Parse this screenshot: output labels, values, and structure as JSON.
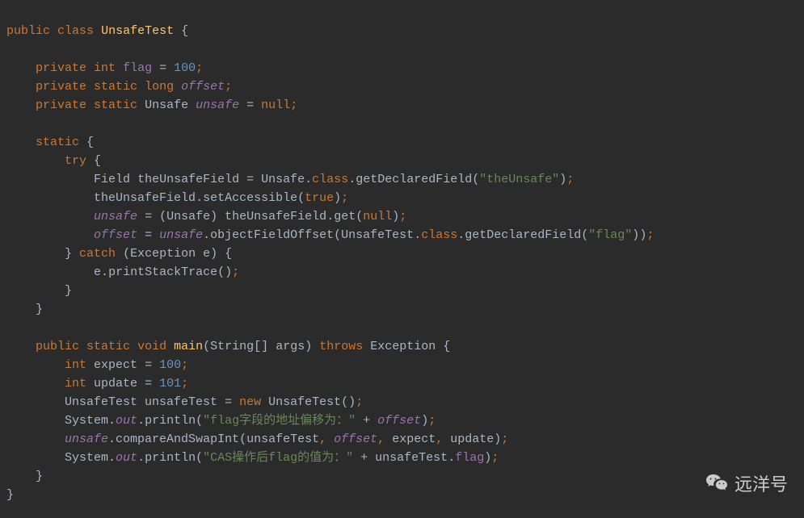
{
  "code": {
    "l1": {
      "kw1": "public",
      "kw2": "class",
      "cls": "UnsafeTest",
      "brace": "{"
    },
    "l2": "",
    "l3": {
      "kw1": "private",
      "kw2": "int",
      "field": "flag",
      "eq": "=",
      "num": "100",
      "semi": ";"
    },
    "l4": {
      "kw1": "private",
      "kw2": "static",
      "kw3": "long",
      "field": "offset",
      "semi": ";"
    },
    "l5": {
      "kw1": "private",
      "kw2": "static",
      "type": "Unsafe",
      "field": "unsafe",
      "eq": "=",
      "null": "null",
      "semi": ";"
    },
    "l6": "",
    "l7": {
      "kw": "static",
      "brace": "{"
    },
    "l8": {
      "kw": "try",
      "brace": "{"
    },
    "l9": {
      "type": "Field",
      "var": "theUnsafeField",
      "eq": "=",
      "cls": "Unsafe",
      "dot1": ".",
      "class": "class",
      "dot2": ".",
      "method": "getDeclaredField",
      "lp": "(",
      "str": "\"theUnsafe\"",
      "rp": ")",
      "semi": ";"
    },
    "l10": {
      "var": "theUnsafeField",
      "dot": ".",
      "method": "setAccessible",
      "lp": "(",
      "true": "true",
      "rp": ")",
      "semi": ";"
    },
    "l11": {
      "field": "unsafe",
      "eq": "=",
      "lp1": "(",
      "cast": "Unsafe",
      "rp1": ")",
      "var": "theUnsafeField",
      "dot": ".",
      "method": "get",
      "lp2": "(",
      "null": "null",
      "rp2": ")",
      "semi": ";"
    },
    "l12": {
      "field1": "offset",
      "eq": "=",
      "field2": "unsafe",
      "dot1": ".",
      "method1": "objectFieldOffset",
      "lp1": "(",
      "cls": "UnsafeTest",
      "dot2": ".",
      "class": "class",
      "dot3": ".",
      "method2": "getDeclaredField",
      "lp2": "(",
      "str": "\"flag\"",
      "rp2": ")",
      "rp1": ")",
      "semi": ";"
    },
    "l13": {
      "rbrace": "}",
      "kw": "catch",
      "lp": "(",
      "type": "Exception",
      "var": "e",
      "rp": ")",
      "lbrace": "{"
    },
    "l14": {
      "var": "e",
      "dot": ".",
      "method": "printStackTrace",
      "lp": "(",
      "rp": ")",
      "semi": ";"
    },
    "l15": {
      "brace": "}"
    },
    "l16": {
      "brace": "}"
    },
    "l17": "",
    "l18": {
      "kw1": "public",
      "kw2": "static",
      "kw3": "void",
      "method": "main",
      "lp": "(",
      "type": "String",
      "arr": "[]",
      "param": "args",
      "rp": ")",
      "kw4": "throws",
      "exc": "Exception",
      "brace": "{"
    },
    "l19": {
      "kw": "int",
      "var": "expect",
      "eq": "=",
      "num": "100",
      "semi": ";"
    },
    "l20": {
      "kw": "int",
      "var": "update",
      "eq": "=",
      "num": "101",
      "semi": ";"
    },
    "l21": {
      "type": "UnsafeTest",
      "var": "unsafeTest",
      "eq": "=",
      "kw": "new",
      "ctor": "UnsafeTest",
      "lp": "(",
      "rp": ")",
      "semi": ";"
    },
    "l22": {
      "cls": "System",
      "dot1": ".",
      "out": "out",
      "dot2": ".",
      "method": "println",
      "lp": "(",
      "str": "\"flag字段的地址偏移为：\"",
      "plus": "+",
      "field": "offset",
      "rp": ")",
      "semi": ";"
    },
    "l23": {
      "field": "unsafe",
      "dot": ".",
      "method": "compareAndSwapInt",
      "lp": "(",
      "a1": "unsafeTest",
      "c1": ",",
      "a2": "offset",
      "c2": ",",
      "a3": "expect",
      "c3": ",",
      "a4": "update",
      "rp": ")",
      "semi": ";"
    },
    "l24": {
      "cls": "System",
      "dot1": ".",
      "out": "out",
      "dot2": ".",
      "method": "println",
      "lp": "(",
      "str": "\"CAS操作后flag的值为：\"",
      "plus": "+",
      "var": "unsafeTest",
      "dot3": ".",
      "fld": "flag",
      "rp": ")",
      "semi": ";"
    },
    "l25": {
      "brace": "}"
    },
    "l26": {
      "brace": "}"
    }
  },
  "watermark": "远洋号"
}
